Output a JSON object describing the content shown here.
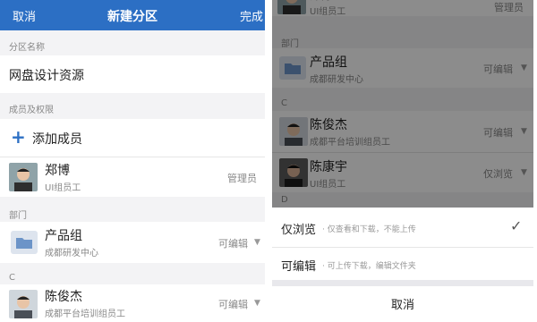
{
  "left": {
    "nav": {
      "cancel": "取消",
      "title": "新建分区",
      "done": "完成"
    },
    "partition_name_label": "分区名称",
    "partition_name_value": "网盘设计资源",
    "members_label": "成员及权限",
    "add_member": "添加成员",
    "member1": {
      "name": "郑博",
      "role_line": "UI组员工",
      "permission": "管理员"
    },
    "dept_label": "部门",
    "dept1": {
      "name": "产品组",
      "sub": "成都研发中心",
      "permission": "可编辑"
    },
    "letter_c": "C",
    "member2": {
      "name": "陈俊杰",
      "sub": "成都平台培训组员工",
      "permission": "可编辑"
    }
  },
  "right": {
    "top_member": {
      "name": "郑博",
      "sub": "UI组员工",
      "permission": "管理员"
    },
    "dept_label": "部门",
    "dept1": {
      "name": "产品组",
      "sub": "成都研发中心",
      "permission": "可编辑"
    },
    "letter_c": "C",
    "member1": {
      "name": "陈俊杰",
      "sub": "成都平台培训组员工",
      "permission": "可编辑"
    },
    "member2": {
      "name": "陈康宇",
      "sub": "UI组员工",
      "permission": "仅浏览"
    },
    "letter_d": "D",
    "sheet": {
      "option1": {
        "title": "仅浏览",
        "desc": "· 仅查看和下载，不能上传",
        "check": "✓"
      },
      "option2": {
        "title": "可编辑",
        "desc": "· 可上传下载，编辑文件夹"
      },
      "cancel": "取消"
    }
  },
  "icons": {
    "add": "plus-icon",
    "folder": "folder-icon",
    "caret": "caret-down-icon",
    "check": "check-icon"
  },
  "colors": {
    "nav_bg": "#2c6fc4",
    "accent": "#2c6fc4"
  }
}
